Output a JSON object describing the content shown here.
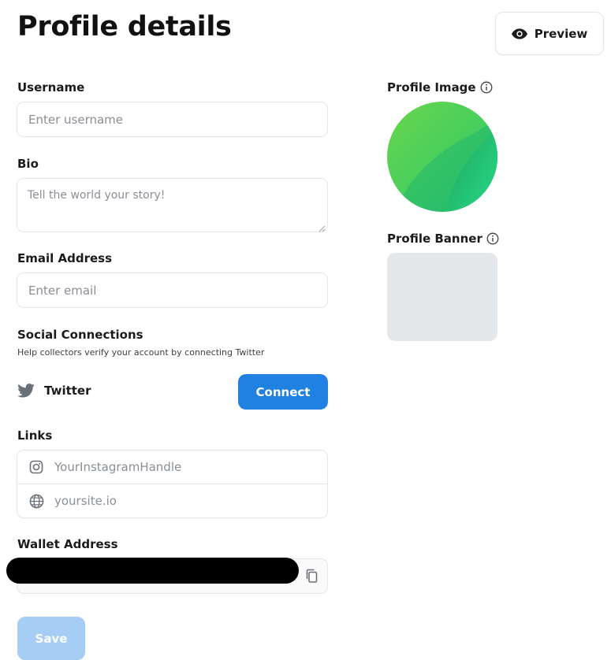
{
  "header": {
    "title": "Profile details",
    "preview_label": "Preview"
  },
  "form": {
    "username": {
      "label": "Username",
      "placeholder": "Enter username"
    },
    "bio": {
      "label": "Bio",
      "placeholder": "Tell the world your story!"
    },
    "email": {
      "label": "Email Address",
      "placeholder": "Enter email"
    },
    "social": {
      "label": "Social Connections",
      "help": "Help collectors verify your account by connecting Twitter",
      "twitter_label": "Twitter",
      "connect_label": "Connect"
    },
    "links": {
      "label": "Links",
      "items": [
        {
          "icon": "instagram-icon",
          "placeholder": "YourInstagramHandle"
        },
        {
          "icon": "globe-icon",
          "placeholder": "yoursite.io"
        }
      ]
    },
    "wallet": {
      "label": "Wallet Address",
      "value": ""
    },
    "save_label": "Save"
  },
  "side": {
    "profile_image_label": "Profile Image",
    "profile_banner_label": "Profile Banner"
  },
  "colors": {
    "accent": "#2081e2",
    "save_disabled": "#a6cdf4",
    "border": "#e4e6ea",
    "banner_placeholder": "#e5e8eb"
  }
}
